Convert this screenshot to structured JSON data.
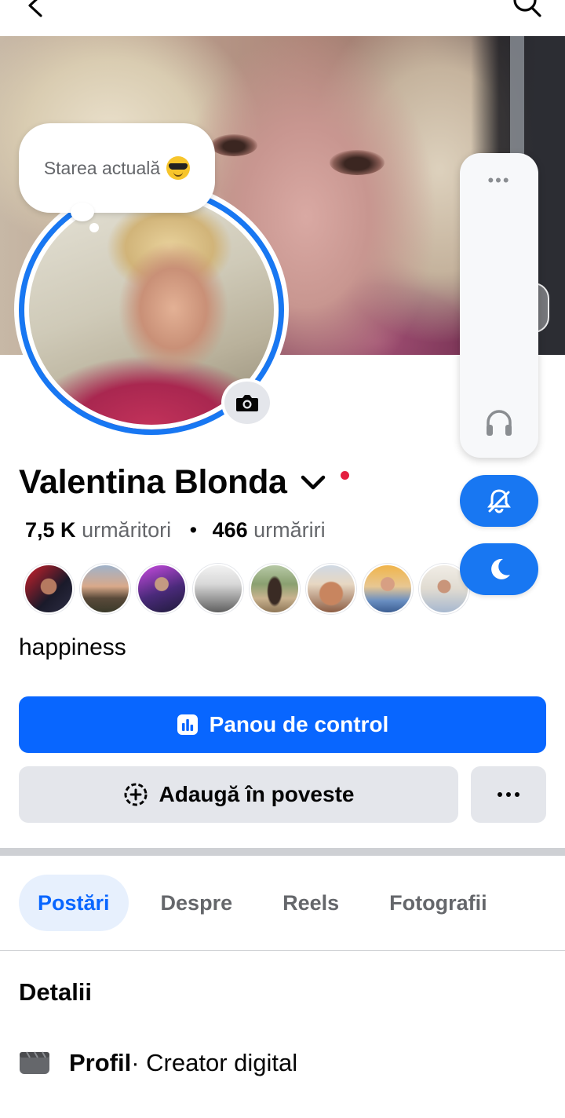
{
  "status": {
    "text": "Starea actuală"
  },
  "profile": {
    "name": "Valentina Blonda",
    "followers_count": "7,5 K",
    "followers_label": "urmăritori",
    "separator": "•",
    "following_count": "466",
    "following_label": "urmăriri",
    "bio": "happiness"
  },
  "buttons": {
    "dashboard": "Panou de control",
    "add_story": "Adaugă în poveste"
  },
  "tabs": [
    "Postări",
    "Despre",
    "Reels",
    "Fotografii"
  ],
  "details": {
    "title": "Detalii",
    "profile_label": "Profil",
    "profile_value": " · Creator digital"
  },
  "colors": {
    "accent": "#0866ff",
    "ring": "#1877f2",
    "notification_dot": "#e41e3f",
    "button_gray": "#e4e6eb"
  },
  "icons": [
    "back-icon",
    "search-icon",
    "camera-icon",
    "chevron-down-icon",
    "more-icon",
    "headphones-icon",
    "bell-off-icon",
    "moon-icon",
    "dashboard-icon",
    "add-story-icon",
    "profile-category-icon"
  ]
}
